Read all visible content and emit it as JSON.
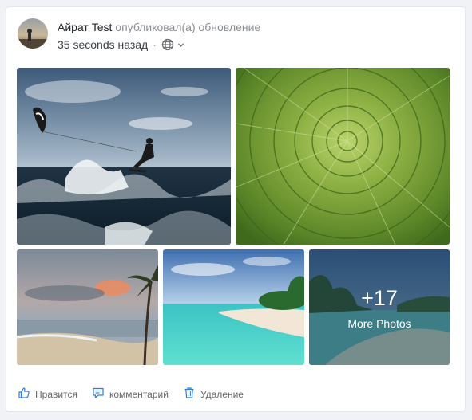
{
  "post": {
    "author": "Айрат Test",
    "action_text": "опубликовал(а) обновление",
    "timestamp": "35 seconds назад",
    "separator": "·",
    "privacy_icon": "globe-icon",
    "privacy_dropdown_icon": "chevron-down-icon"
  },
  "gallery": {
    "photos": [
      {
        "subject": "kitesurfer-on-ocean-waves"
      },
      {
        "subject": "green-succulent-spiral"
      },
      {
        "subject": "beach-with-palm-tree-at-sunset"
      },
      {
        "subject": "tropical-beach-turquoise-water"
      },
      {
        "subject": "tropical-island-palm-trees"
      }
    ],
    "more_count": "+17",
    "more_label": "More Photos"
  },
  "footer": {
    "like_label": "Нравится",
    "like_icon": "thumbs-up-icon",
    "comment_label": "комментарий",
    "comment_icon": "comment-icon",
    "delete_label": "Удаление",
    "delete_icon": "trash-icon"
  },
  "colors": {
    "accent": "#2e7dd6",
    "background": "#f0f2f5",
    "card": "#ffffff"
  }
}
